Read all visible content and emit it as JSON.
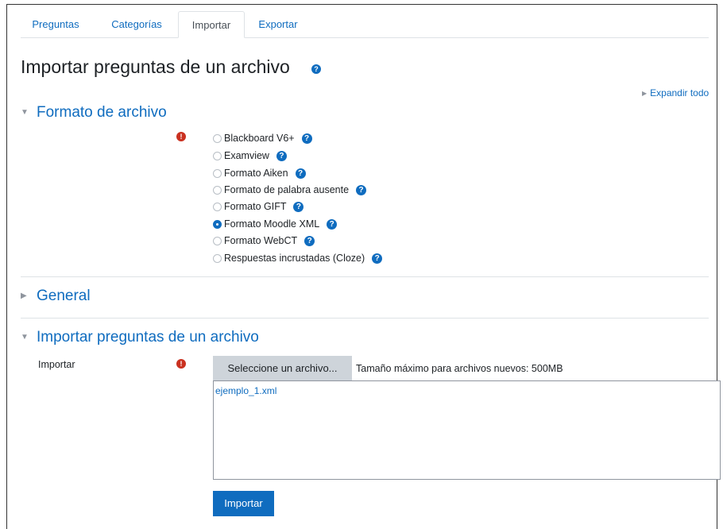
{
  "tabs": [
    {
      "label": "Preguntas",
      "active": false
    },
    {
      "label": "Categorías",
      "active": false
    },
    {
      "label": "Importar",
      "active": true
    },
    {
      "label": "Exportar",
      "active": false
    }
  ],
  "page_title": "Importar preguntas de un archivo",
  "expand_all": "Expandir todo",
  "sections": {
    "format": {
      "title": "Formato de archivo",
      "expanded": true
    },
    "general": {
      "title": "General",
      "expanded": false
    },
    "import": {
      "title": "Importar preguntas de un archivo",
      "expanded": true
    }
  },
  "format_options": [
    {
      "label": "Blackboard V6+",
      "checked": false
    },
    {
      "label": "Examview",
      "checked": false
    },
    {
      "label": "Formato Aiken",
      "checked": false
    },
    {
      "label": "Formato de palabra ausente",
      "checked": false
    },
    {
      "label": "Formato GIFT",
      "checked": false
    },
    {
      "label": "Formato Moodle XML",
      "checked": true
    },
    {
      "label": "Formato WebCT",
      "checked": false
    },
    {
      "label": "Respuestas incrustadas (Cloze)",
      "checked": false
    }
  ],
  "import_field": {
    "label": "Importar",
    "choose_button": "Seleccione un archivo...",
    "max_size": "Tamaño máximo para archivos nuevos: 500MB",
    "file_name": "ejemplo_1.xml"
  },
  "submit_label": "Importar",
  "icons": {
    "help": "question-circle-icon",
    "required": "exclamation-circle-icon"
  },
  "colors": {
    "link": "#0f6cbf",
    "required": "#ca3120",
    "border": "#dee2e6"
  }
}
